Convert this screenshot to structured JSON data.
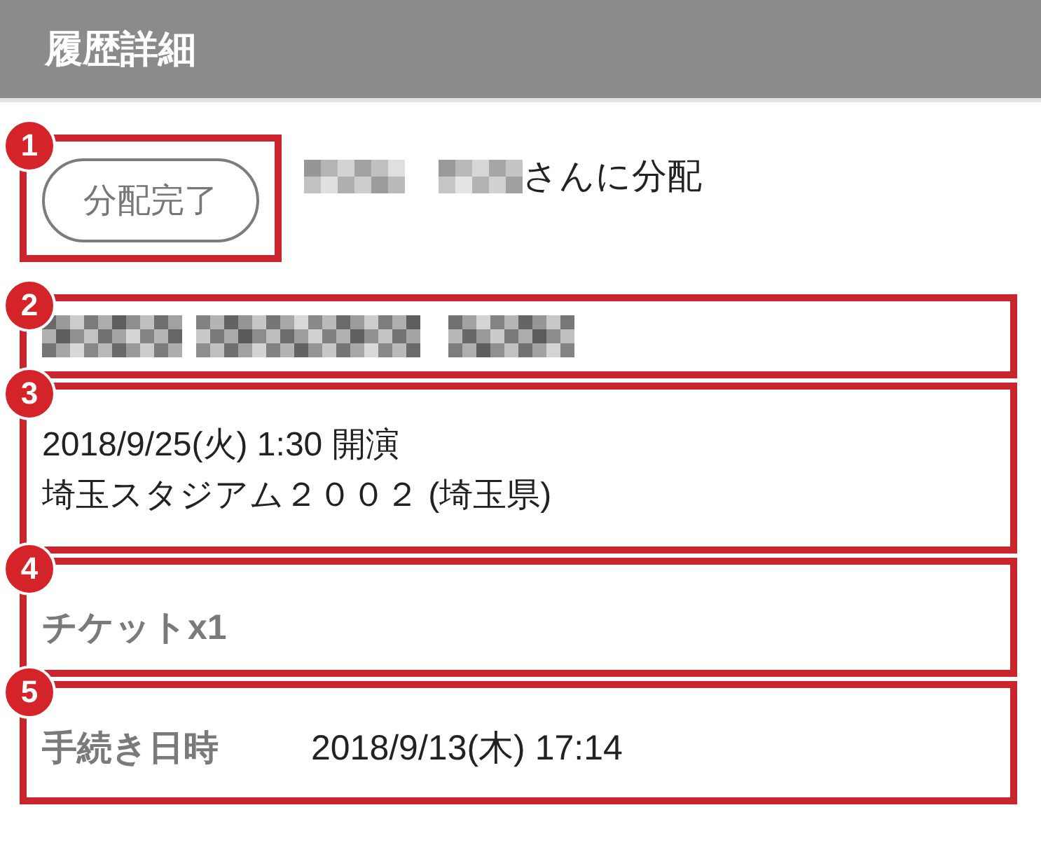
{
  "header": {
    "title": "履歴詳細"
  },
  "sections": [
    {
      "kind": "status",
      "marker": "1",
      "tag": "分配完了",
      "recipient_redacted": true,
      "text": "さんに分配"
    },
    {
      "kind": "redacted",
      "marker": "2"
    },
    {
      "kind": "lines",
      "marker": "3",
      "lines": [
        "2018/9/25(火) 1:30 開演",
        "埼玉スタジアム２００２ (埼玉県)"
      ]
    },
    {
      "kind": "label",
      "marker": "4",
      "label": "チケットx1"
    },
    {
      "kind": "field",
      "marker": "5",
      "label": "手続き日時",
      "value": "2018/9/13(木) 17:14"
    }
  ]
}
